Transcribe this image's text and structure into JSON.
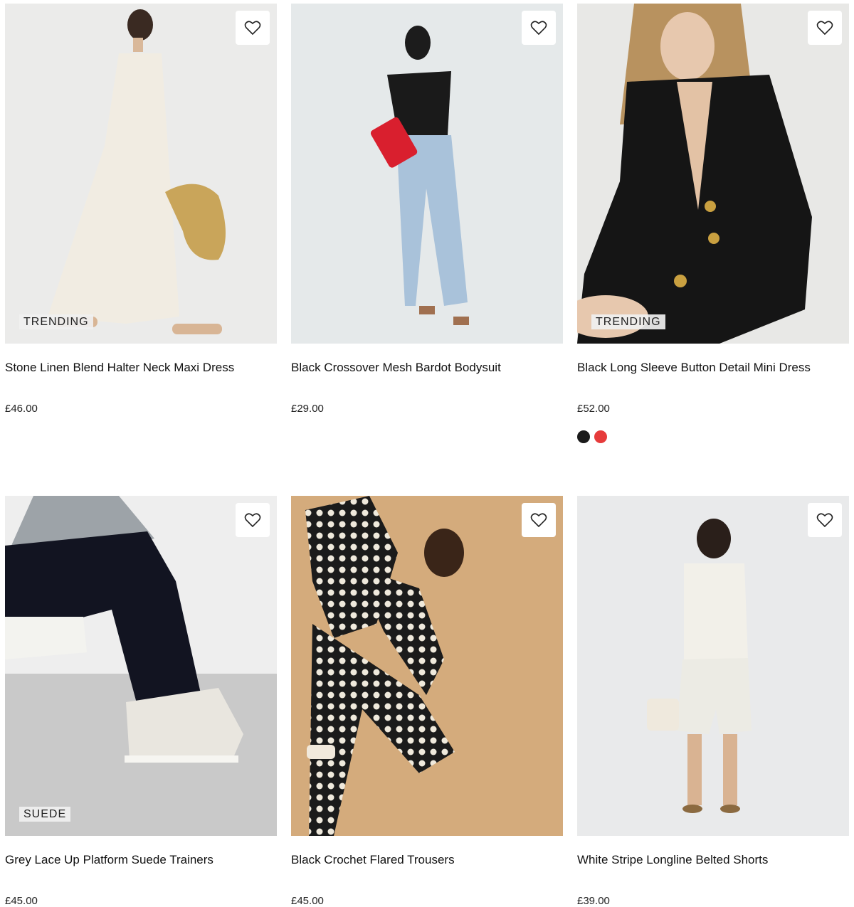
{
  "products": [
    {
      "title": "Stone Linen Blend Halter Neck Maxi Dress",
      "price": "£46.00",
      "badge": "TRENDING",
      "bg": "#ebebea",
      "swatches": []
    },
    {
      "title": "Black Crossover Mesh Bardot Bodysuit",
      "price": "£29.00",
      "badge": "",
      "bg": "#e5e9ea",
      "swatches": []
    },
    {
      "title": "Black Long Sleeve Button Detail Mini Dress",
      "price": "£52.00",
      "badge": "TRENDING",
      "bg": "#e8e8e6",
      "swatches": [
        "#1a1a1a",
        "#e63b3b"
      ]
    },
    {
      "title": "Grey Lace Up Platform Suede Trainers",
      "price": "£45.00",
      "badge": "SUEDE",
      "bg": "#eeeeee",
      "swatches": []
    },
    {
      "title": "Black Crochet Flared Trousers",
      "price": "£45.00",
      "badge": "",
      "bg": "#d4ab7c",
      "swatches": []
    },
    {
      "title": "White Stripe Longline Belted Shorts",
      "price": "£39.00",
      "badge": "",
      "bg": "#e9eaeb",
      "swatches": []
    }
  ],
  "icons": {
    "wishlist": "heart-icon"
  }
}
